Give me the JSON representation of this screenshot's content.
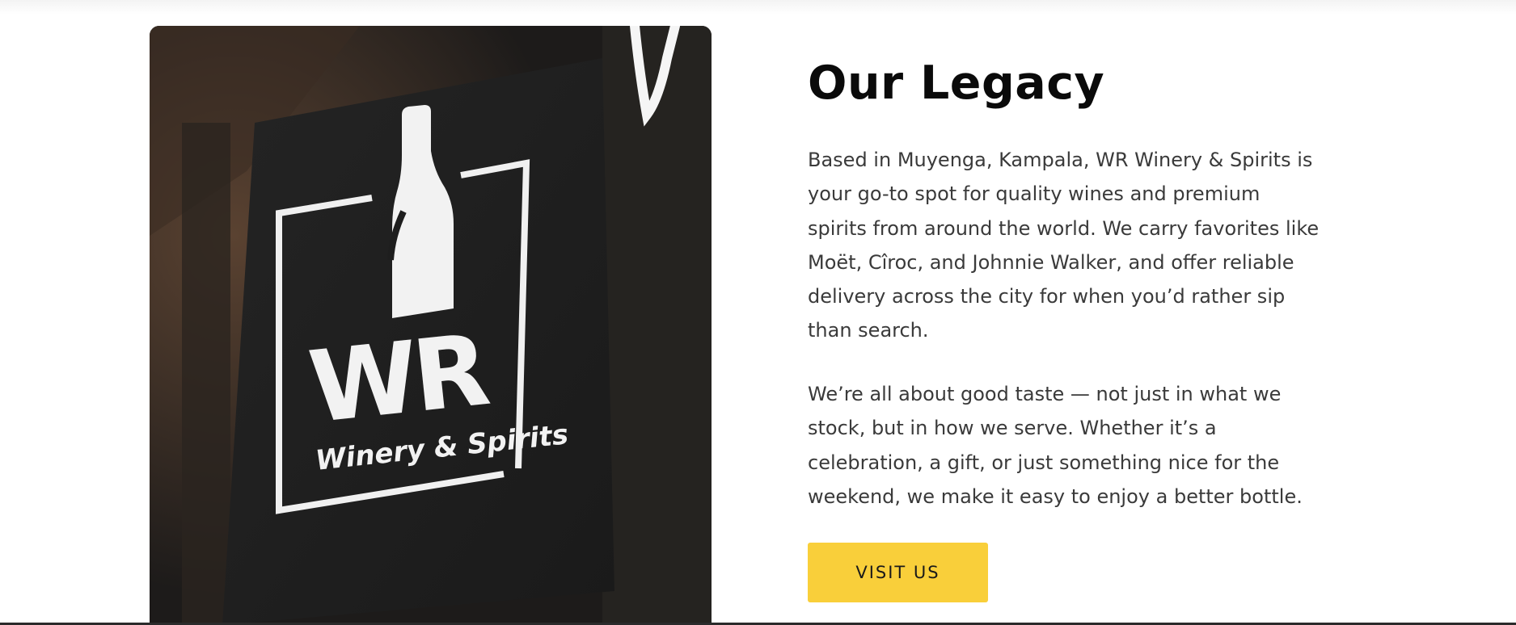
{
  "legacy_section": {
    "title": "Our Legacy",
    "paragraph_1": "Based in Muyenga, Kampala, WR Winery & Spirits is\nyour go-to spot for quality wines and premium\nspirits from around the world. We carry favorites like\nMoët, Cîroc, and Johnnie Walker, and offer reliable\ndelivery across the city for when you’d rather sip\nthan search.",
    "paragraph_2": "We’re all about good taste — not just in what we\nstock, but in how we serve. Whether it’s a\ncelebration, a gift, or just something nice for the\nweekend, we make it easy to enjoy a better bottle.",
    "cta_label": "VISIT US"
  },
  "sign_image": {
    "logo_letters": "WR",
    "logo_subtitle": "Winery & Spirits"
  },
  "colors": {
    "accent": "#f9cf3a",
    "heading": "#0a0a0a",
    "body_text": "#3a3a3a",
    "sign_background": "#1f1f1f",
    "sign_foreground": "#f2f2f2"
  }
}
